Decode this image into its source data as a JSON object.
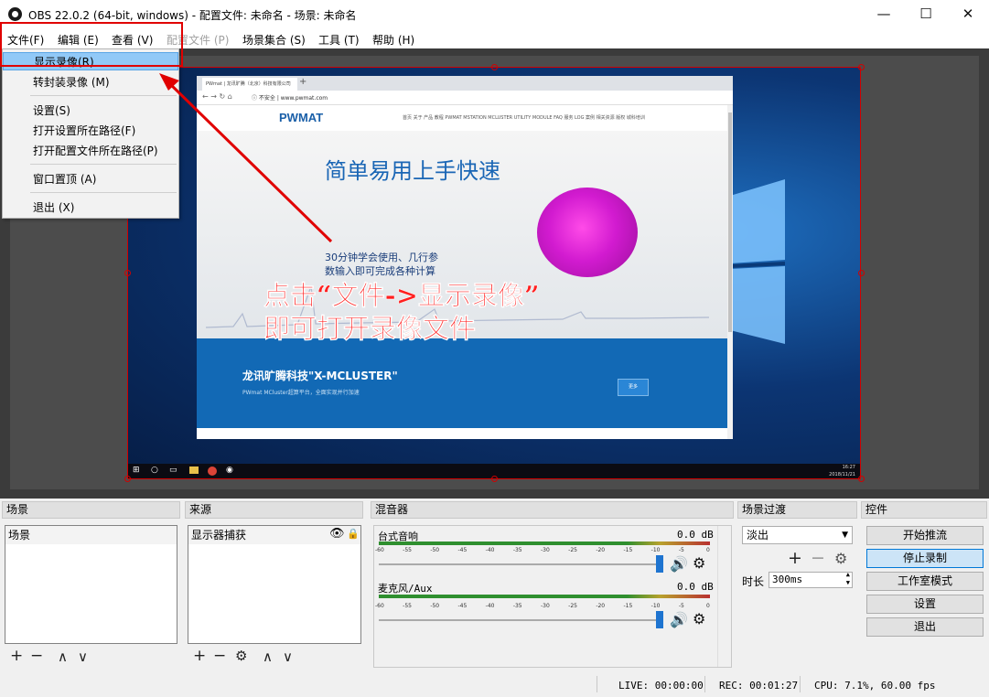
{
  "window": {
    "title": "OBS 22.0.2 (64-bit, windows) - 配置文件: 未命名 - 场景: 未命名",
    "minimize": "—",
    "maximize": "☐",
    "close": "✕"
  },
  "menu": {
    "items": [
      {
        "label": "文件(F)",
        "disabled": false
      },
      {
        "label": "编辑 (E)",
        "disabled": false
      },
      {
        "label": "查看 (V)",
        "disabled": false
      },
      {
        "label": "配置文件 (P)",
        "disabled": true
      },
      {
        "label": "场景集合 (S)",
        "disabled": false
      },
      {
        "label": "工具 (T)",
        "disabled": false
      },
      {
        "label": "帮助 (H)",
        "disabled": false
      }
    ]
  },
  "file_menu": {
    "items": [
      {
        "label": "显示录像(R)",
        "active": true
      },
      {
        "label": "转封装录像 (M)"
      },
      {
        "label": "设置(S)"
      },
      {
        "label": "打开设置所在路径(F)"
      },
      {
        "label": "打开配置文件所在路径(P)"
      },
      {
        "label": "窗口置顶 (A)"
      },
      {
        "label": "退出 (X)"
      }
    ]
  },
  "preview": {
    "browser_tab": "PWmat | 龙讯旷腾（北京）科技有限公司",
    "browser_url": "ⓘ 不安全 | www.pwmat.com",
    "site_logo": "PWMAT",
    "site_nav": "首页  关于  产品  教程  PWMAT  MSTATION  MCLUSTER  UTILITY  MODULE  FAQ  服务  LOG  案例  相关资源  版权  城科培训",
    "hero_title": "简单易用上手快速",
    "hero_sub1": "30分钟学会使用、几行参",
    "hero_sub2": "数输入即可完成各种计算",
    "band_title": "龙讯旷腾科技\"X-MCLUSTER\"",
    "band_sub": "PWmat MCluster超算平台，全面实现并行加速",
    "band_btn": "更多",
    "taskbar_time": "16:27",
    "taskbar_date": "2018/11/21"
  },
  "annotation": {
    "line1": "点击“文件->显示录像”",
    "line2": "即可打开录像文件"
  },
  "docks": {
    "scenes": {
      "title": "场景",
      "items": [
        "场景"
      ]
    },
    "sources": {
      "title": "来源",
      "items": [
        "显示器捕获"
      ]
    },
    "mixer": {
      "title": "混音器",
      "channels": [
        {
          "name": "台式音响",
          "db": "0.0 dB",
          "level": 0.9
        },
        {
          "name": "麦克风/Aux",
          "db": "0.0 dB",
          "level": 0.85
        }
      ],
      "scale": [
        "-60",
        "-55",
        "-50",
        "-45",
        "-40",
        "-35",
        "-30",
        "-25",
        "-20",
        "-15",
        "-10",
        "-5",
        "0"
      ]
    },
    "transitions": {
      "title": "场景过渡",
      "selected": "淡出",
      "duration_label": "时长",
      "duration_value": "300ms"
    },
    "controls": {
      "title": "控件",
      "buttons": [
        {
          "label": "开始推流",
          "pressed": false
        },
        {
          "label": "停止录制",
          "pressed": true
        },
        {
          "label": "工作室模式",
          "pressed": false
        },
        {
          "label": "设置",
          "pressed": false
        },
        {
          "label": "退出",
          "pressed": false
        }
      ]
    }
  },
  "status": {
    "live": "LIVE: 00:00:00",
    "rec": "REC: 00:01:27",
    "cpu": "CPU: 7.1%, 60.00 fps"
  },
  "colors": {
    "annotation_red": "#ff2020",
    "selection_red": "#d20000",
    "menu_highlight": "#91c9f7",
    "button_pressed": "#cce4f7"
  }
}
